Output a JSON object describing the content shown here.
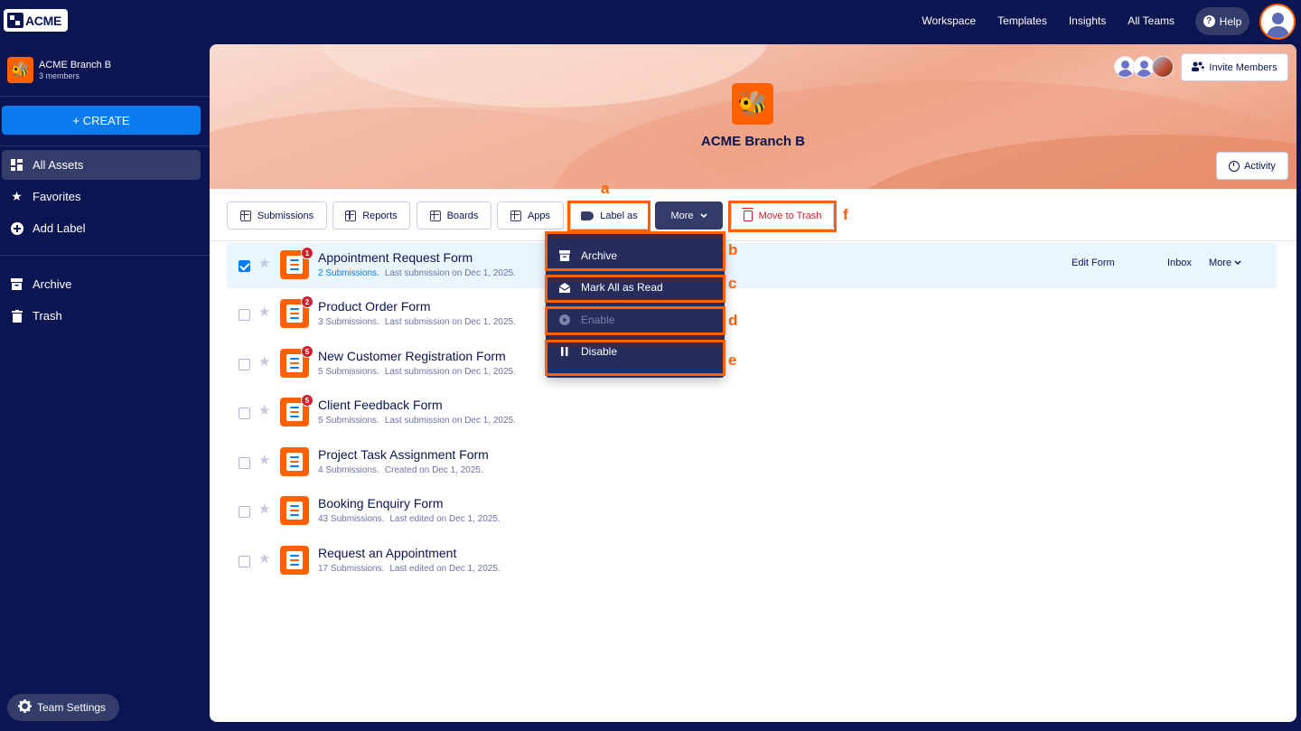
{
  "topnav": {
    "logo_text": "ACME",
    "links": [
      "Workspace",
      "Templates",
      "Insights",
      "All Teams"
    ],
    "help_label": "Help"
  },
  "sidebar": {
    "team_name": "ACME Branch B",
    "team_members": "3 members",
    "create_label": "+ CREATE",
    "items": [
      {
        "label": "All Assets",
        "icon": "grid-icon",
        "active": true
      },
      {
        "label": "Favorites",
        "icon": "star-icon"
      },
      {
        "label": "Add Label",
        "icon": "plus-circle-icon"
      },
      {
        "label": "Archive",
        "icon": "archive-icon"
      },
      {
        "label": "Trash",
        "icon": "trash-icon"
      }
    ],
    "settings_label": "Team Settings"
  },
  "banner": {
    "title": "ACME Branch B",
    "invite_label": "Invite Members",
    "activity_label": "Activity"
  },
  "toolbar": {
    "submissions": "Submissions",
    "reports": "Reports",
    "boards": "Boards",
    "apps": "Apps",
    "label_as": "Label as",
    "more": "More",
    "move_to_trash": "Move to Trash"
  },
  "dropdown": {
    "items": [
      {
        "label": "Archive",
        "icon": "archive-icon",
        "enabled": true
      },
      {
        "label": "Mark All as Read",
        "icon": "envelope-open-icon",
        "enabled": true
      },
      {
        "label": "Enable",
        "icon": "play-icon",
        "enabled": false
      },
      {
        "label": "Disable",
        "icon": "pause-icon",
        "enabled": true
      }
    ]
  },
  "annotations": [
    "a",
    "b",
    "c",
    "d",
    "e",
    "f"
  ],
  "forms": [
    {
      "title": "Appointment Request Form",
      "submissions": "2 Submissions.",
      "detail": "Last submission on Dec 1, 2025.",
      "badge": "1",
      "selected": true
    },
    {
      "title": "Product Order Form",
      "submissions": "3 Submissions.",
      "detail": "Last submission on Dec 1, 2025.",
      "badge": "2"
    },
    {
      "title": "New Customer Registration Form",
      "submissions": "5 Submissions.",
      "detail": "Last submission on Dec 1, 2025.",
      "badge": "5"
    },
    {
      "title": "Client Feedback Form",
      "submissions": "5 Submissions.",
      "detail": "Last submission on Dec 1, 2025.",
      "badge": "5"
    },
    {
      "title": "Project Task Assignment Form",
      "submissions": "4 Submissions.",
      "detail": "Created on Dec 1, 2025."
    },
    {
      "title": "Booking Enquiry Form",
      "submissions": "43 Submissions.",
      "detail": "Last edited on Dec 1, 2025."
    },
    {
      "title": "Request an Appointment",
      "submissions": "17 Submissions.",
      "detail": "Last edited on Dec 1, 2025."
    }
  ],
  "row_actions": {
    "edit": "Edit Form",
    "inbox": "Inbox",
    "more": "More"
  },
  "colors": {
    "navy": "#0a1551",
    "accent": "#ff6100",
    "blue": "#0a7cf0",
    "danger": "#d11f2e"
  }
}
